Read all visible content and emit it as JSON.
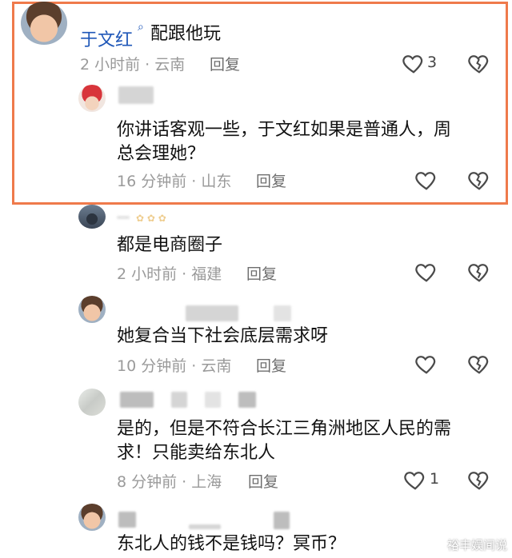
{
  "comments": [
    {
      "name_text": "于文红",
      "text_after_name": "配跟他玩",
      "meta": "2 小时前 · 云南",
      "reply_label": "回复",
      "like_count": "3"
    },
    {
      "line1": "你讲话客观一些，于文红如果是普通人，周",
      "line2": "总会理她？",
      "meta": "16 分钟前 · 山东",
      "reply_label": "回复"
    },
    {
      "line1": "都是电商圈子",
      "meta": "2 小时前 · 福建",
      "reply_label": "回复"
    },
    {
      "line1": "她复合当下社会底层需求呀",
      "meta": "10 分钟前 · 云南",
      "reply_label": "回复"
    },
    {
      "line1": "是的，但是不符合长江三角洲地区人民的需",
      "line2": "求！只能卖给东北人",
      "meta": "8 分钟前 · 上海",
      "reply_label": "回复",
      "like_count": "1"
    },
    {
      "line1": "东北人的钱不是钱吗？冥币？"
    }
  ],
  "watermark": "裕丰娱间说",
  "colors": {
    "highlight_border": "#ef7a4b",
    "name_link": "#1f57b8"
  },
  "icons": [
    "heart-icon",
    "heartbreak-icon",
    "search-icon"
  ]
}
